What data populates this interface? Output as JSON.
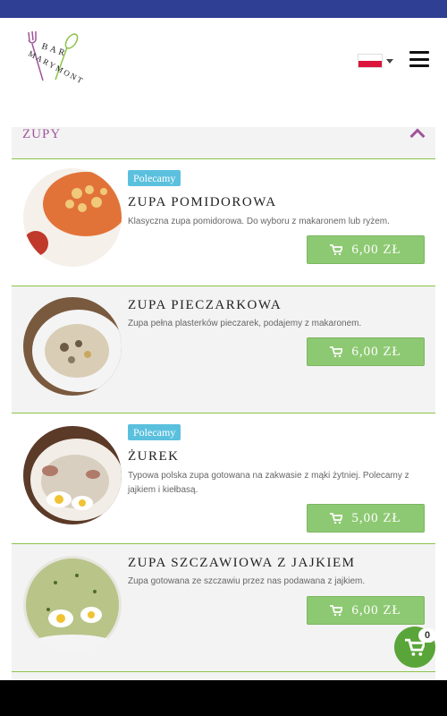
{
  "brand": {
    "logo_text": "BAR MARYMONT"
  },
  "header": {
    "language": "pl"
  },
  "section": {
    "title": "ZUPY"
  },
  "items": [
    {
      "badge": "Polecamy",
      "name": "ZUPA POMIDOROWA",
      "description": "Klasyczna zupa pomidorowa. Do wyboru z makaronem lub ryżem.",
      "price": "6,00 ZŁ"
    },
    {
      "badge": "",
      "name": "ZUPA PIECZARKOWA",
      "description": "Zupa pełna plasterków pieczarek, podajemy z makaronem.",
      "price": "6,00 ZŁ"
    },
    {
      "badge": "Polecamy",
      "name": "ŻUREK",
      "description": "Typowa polska zupa gotowana na zakwasie z mąki żytniej. Polecamy z jajkiem i kiełbasą.",
      "price": "5,00 ZŁ"
    },
    {
      "badge": "",
      "name": "ZUPA SZCZAWIOWA Z JAJKIEM",
      "description": "Zupa gotowana ze szczawiu przez nas podawana z jajkiem.",
      "price": "6,00 ZŁ"
    }
  ],
  "cart": {
    "count": "0"
  },
  "colors": {
    "topbar": "#2f3f93",
    "accent": "#a0549a",
    "price_button": "#8dc972",
    "badge": "#5bc0de",
    "fab": "#5aa53a"
  },
  "icons": {
    "cart": "shopping-cart-icon",
    "menu": "hamburger-icon",
    "collapse": "chevron-up-icon"
  }
}
